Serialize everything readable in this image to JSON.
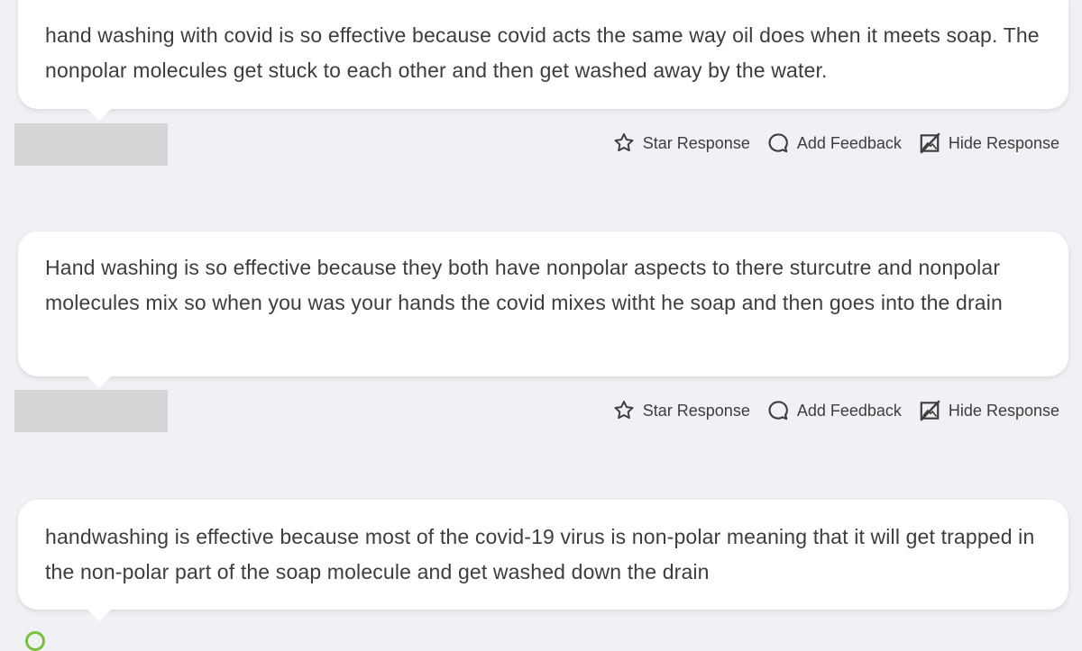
{
  "responses": [
    {
      "text": "hand washing with covid is so effective because covid acts the same way oil does when it meets soap. The nonpolar molecules get stuck to each other and then get washed away by the water.",
      "actions": {
        "star": "Star Response",
        "feedback": "Add Feedback",
        "hide": "Hide Response"
      }
    },
    {
      "text": "Hand washing is so effective because they both have nonpolar aspects to there sturcutre and nonpolar molecules mix so when you was your hands the covid mixes witht he soap and then goes into the drain",
      "actions": {
        "star": "Star Response",
        "feedback": "Add Feedback",
        "hide": "Hide Response"
      }
    },
    {
      "text": "handwashing is effective because most of the covid-19 virus is non-polar meaning that it will get trapped in the non-polar part of the soap molecule and get washed down the drain"
    }
  ],
  "icons": {
    "star": "star-icon",
    "feedback": "speech-bubble-icon",
    "hide": "crossed-out-square-icon",
    "status": "check-circle-icon"
  },
  "colors": {
    "background": "#f0f1f4",
    "bubble": "#ffffff",
    "text": "#3d3d3d",
    "name_redaction": "#d5d5d7",
    "status_green": "#7cbf3f"
  }
}
